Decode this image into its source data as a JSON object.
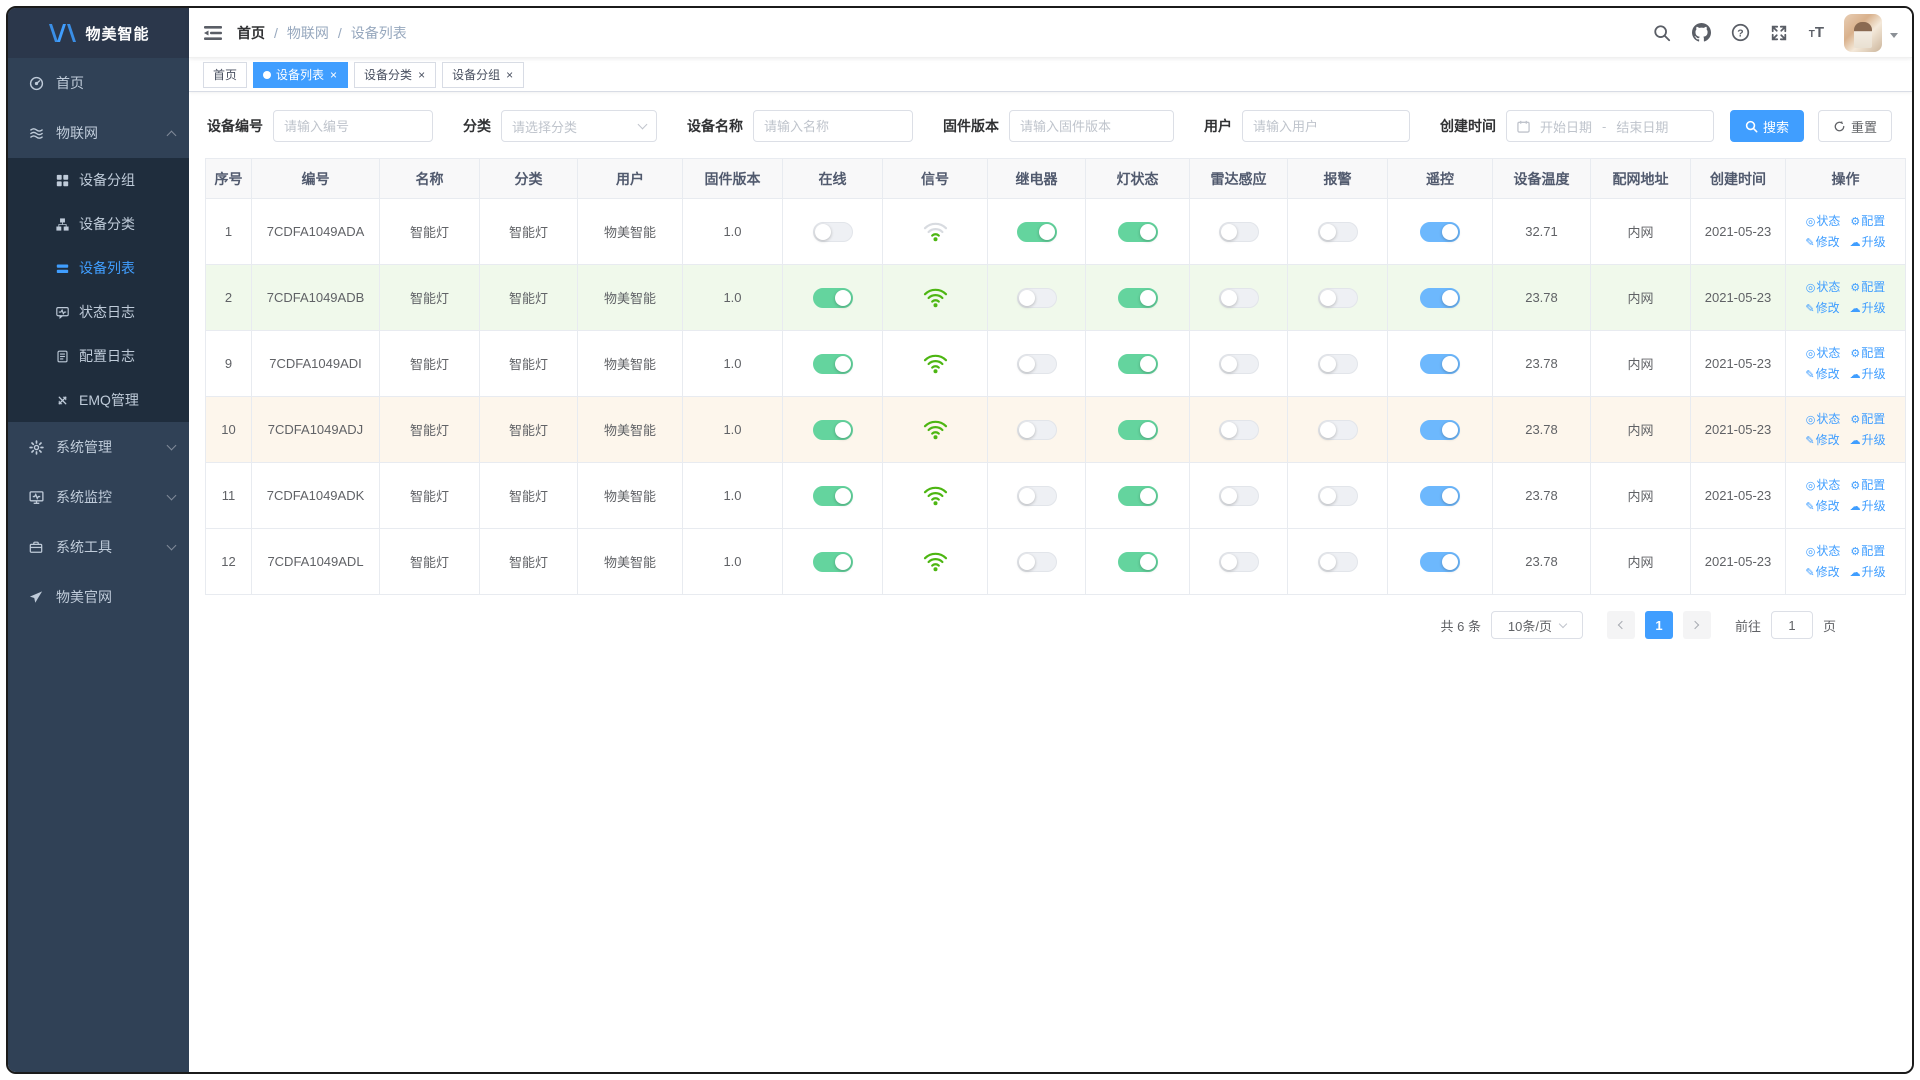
{
  "brand": {
    "name": "物美智能"
  },
  "colors": {
    "primary": "#409EFF",
    "toggle_green": "#64d49e",
    "toggle_blue": "#6db8fd",
    "toggle_off": "#eef0f4",
    "wifi_green": "#4db612",
    "row_green": "#f0f9eb",
    "row_orange": "#fdf6ec",
    "sidebar_bg": "#304156",
    "submenu_bg": "#1f2d3d"
  },
  "sidebar": {
    "items": [
      {
        "key": "home",
        "label": "首页",
        "icon": "dashboard-icon"
      },
      {
        "key": "iot",
        "label": "物联网",
        "icon": "iot-icon",
        "expanded": true,
        "children": [
          {
            "key": "device-group",
            "label": "设备分组",
            "icon": "grid-icon"
          },
          {
            "key": "device-category",
            "label": "设备分类",
            "icon": "sitemap-icon"
          },
          {
            "key": "device-list",
            "label": "设备列表",
            "icon": "list-icon",
            "active": true
          },
          {
            "key": "status-log",
            "label": "状态日志",
            "icon": "status-log-icon"
          },
          {
            "key": "config-log",
            "label": "配置日志",
            "icon": "config-log-icon"
          },
          {
            "key": "emq-manage",
            "label": "EMQ管理",
            "icon": "emq-icon"
          }
        ]
      },
      {
        "key": "system-manage",
        "label": "系统管理",
        "icon": "gear-icon",
        "collapsible": true
      },
      {
        "key": "system-monitor",
        "label": "系统监控",
        "icon": "monitor-icon",
        "collapsible": true
      },
      {
        "key": "system-tools",
        "label": "系统工具",
        "icon": "tools-icon",
        "collapsible": true
      },
      {
        "key": "official-site",
        "label": "物美官网",
        "icon": "send-icon"
      }
    ]
  },
  "header": {
    "breadcrumb": [
      "首页",
      "物联网",
      "设备列表"
    ],
    "right_icons": [
      "search-icon",
      "github-icon",
      "help-icon",
      "fullscreen-icon",
      "font-size-icon"
    ]
  },
  "tabs": [
    {
      "key": "home",
      "label": "首页",
      "active": false,
      "closable": false
    },
    {
      "key": "device-list",
      "label": "设备列表",
      "active": true,
      "closable": true
    },
    {
      "key": "device-category",
      "label": "设备分类",
      "active": false,
      "closable": true
    },
    {
      "key": "device-group",
      "label": "设备分组",
      "active": false,
      "closable": true
    }
  ],
  "filters": {
    "device_no": {
      "label": "设备编号",
      "placeholder": "请输入编号"
    },
    "category": {
      "label": "分类",
      "placeholder": "请选择分类"
    },
    "device_name": {
      "label": "设备名称",
      "placeholder": "请输入名称"
    },
    "firmware": {
      "label": "固件版本",
      "placeholder": "请输入固件版本"
    },
    "user": {
      "label": "用户",
      "placeholder": "请输入用户"
    },
    "created": {
      "label": "创建时间",
      "start_placeholder": "开始日期",
      "separator": "-",
      "end_placeholder": "结束日期"
    },
    "search_label": "搜索",
    "reset_label": "重置"
  },
  "table": {
    "columns": [
      "序号",
      "编号",
      "名称",
      "分类",
      "用户",
      "固件版本",
      "在线",
      "信号",
      "继电器",
      "灯状态",
      "雷达感应",
      "报警",
      "遥控",
      "设备温度",
      "配网地址",
      "创建时间",
      "操作"
    ],
    "action_labels": {
      "status": "状态",
      "config": "配置",
      "edit": "修改",
      "upgrade": "升级"
    },
    "rows": [
      {
        "index": "1",
        "no": "7CDFA1049ADA",
        "name": "智能灯",
        "category": "智能灯",
        "user": "物美智能",
        "firmware": "1.0",
        "online": false,
        "signal": 1,
        "relay": true,
        "light": true,
        "radar": false,
        "alarm": false,
        "remote": true,
        "temp": "32.71",
        "network": "内网",
        "created": "2021-05-23",
        "highlight": "none"
      },
      {
        "index": "2",
        "no": "7CDFA1049ADB",
        "name": "智能灯",
        "category": "智能灯",
        "user": "物美智能",
        "firmware": "1.0",
        "online": true,
        "signal": 3,
        "relay": false,
        "light": true,
        "radar": false,
        "alarm": false,
        "remote": true,
        "temp": "23.78",
        "network": "内网",
        "created": "2021-05-23",
        "highlight": "green"
      },
      {
        "index": "9",
        "no": "7CDFA1049ADI",
        "name": "智能灯",
        "category": "智能灯",
        "user": "物美智能",
        "firmware": "1.0",
        "online": true,
        "signal": 3,
        "relay": false,
        "light": true,
        "radar": false,
        "alarm": false,
        "remote": true,
        "temp": "23.78",
        "network": "内网",
        "created": "2021-05-23",
        "highlight": "none"
      },
      {
        "index": "10",
        "no": "7CDFA1049ADJ",
        "name": "智能灯",
        "category": "智能灯",
        "user": "物美智能",
        "firmware": "1.0",
        "online": true,
        "signal": 3,
        "relay": false,
        "light": true,
        "radar": false,
        "alarm": false,
        "remote": true,
        "temp": "23.78",
        "network": "内网",
        "created": "2021-05-23",
        "highlight": "orange"
      },
      {
        "index": "11",
        "no": "7CDFA1049ADK",
        "name": "智能灯",
        "category": "智能灯",
        "user": "物美智能",
        "firmware": "1.0",
        "online": true,
        "signal": 3,
        "relay": false,
        "light": true,
        "radar": false,
        "alarm": false,
        "remote": true,
        "temp": "23.78",
        "network": "内网",
        "created": "2021-05-23",
        "highlight": "none"
      },
      {
        "index": "12",
        "no": "7CDFA1049ADL",
        "name": "智能灯",
        "category": "智能灯",
        "user": "物美智能",
        "firmware": "1.0",
        "online": true,
        "signal": 3,
        "relay": false,
        "light": true,
        "radar": false,
        "alarm": false,
        "remote": true,
        "temp": "23.78",
        "network": "内网",
        "created": "2021-05-23",
        "highlight": "none"
      }
    ]
  },
  "pagination": {
    "total_text": "共 6 条",
    "page_size": "10条/页",
    "current_page": "1",
    "goto_label": "前往",
    "goto_value": "1",
    "page_suffix": "页"
  }
}
